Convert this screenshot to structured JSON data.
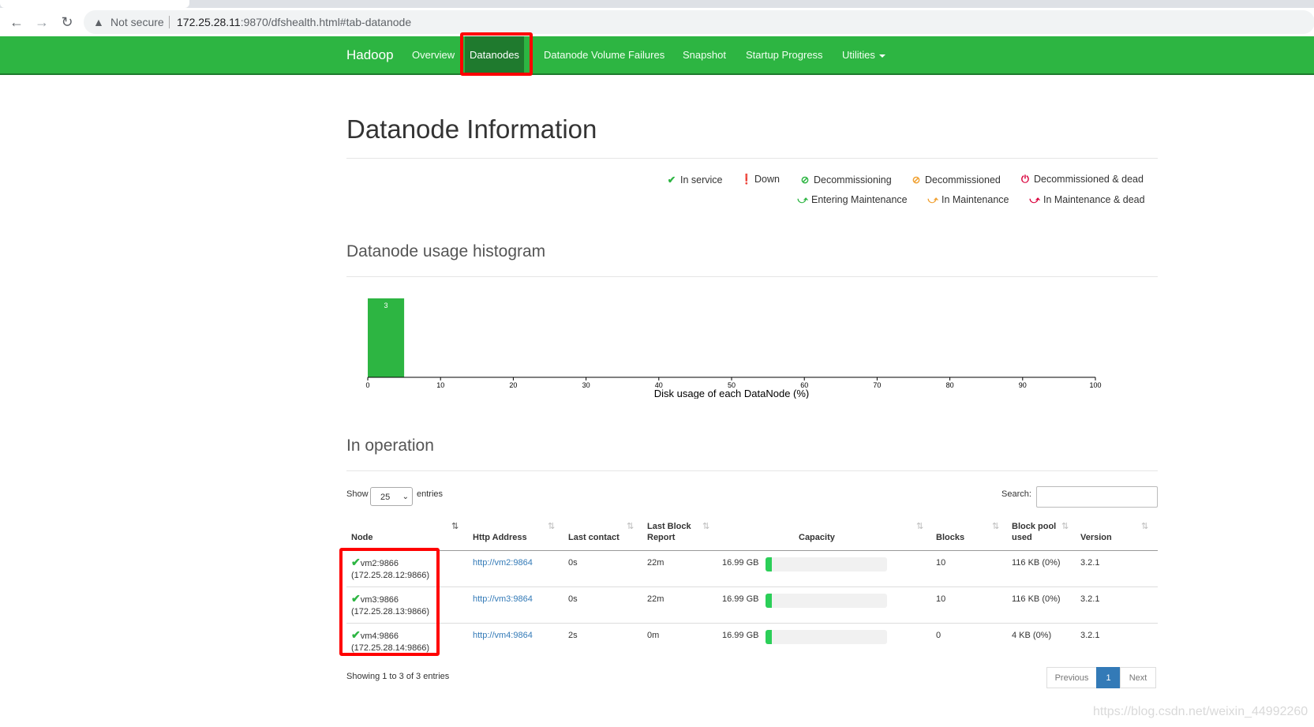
{
  "browser": {
    "security_label": "Not secure",
    "url_host": "172.25.28.11",
    "url_rest": ":9870/dfshealth.html#tab-datanode"
  },
  "navbar": {
    "brand": "Hadoop",
    "items": [
      {
        "label": "Overview"
      },
      {
        "label": "Datanodes"
      },
      {
        "label": "Datanode Volume Failures"
      },
      {
        "label": "Snapshot"
      },
      {
        "label": "Startup Progress"
      },
      {
        "label": "Utilities"
      }
    ],
    "color": "#2db542"
  },
  "page_title": "Datanode Information",
  "legend": [
    {
      "label": "In service",
      "icon": "check-icon",
      "color": "#2db542"
    },
    {
      "label": "Down",
      "icon": "exclamation-circle-icon",
      "color": "#d9003b"
    },
    {
      "label": "Decommissioning",
      "icon": "ban-circle-icon",
      "color": "#2db542"
    },
    {
      "label": "Decommissioned",
      "icon": "ban-circle-icon",
      "color": "#f0a030"
    },
    {
      "label": "Decommissioned & dead",
      "icon": "power-icon",
      "color": "#d9003b"
    },
    {
      "label": "Entering Maintenance",
      "icon": "wrench-icon",
      "color": "#2db542"
    },
    {
      "label": "In Maintenance",
      "icon": "wrench-icon",
      "color": "#f0a030"
    },
    {
      "label": "In Maintenance & dead",
      "icon": "wrench-icon",
      "color": "#d9003b"
    }
  ],
  "histogram": {
    "heading": "Datanode usage histogram",
    "chart_data": {
      "type": "bar",
      "xlabel": "Disk usage of each DataNode (%)",
      "x_ticks": [
        0,
        10,
        20,
        30,
        40,
        50,
        60,
        70,
        80,
        90,
        100
      ],
      "xlim": [
        0,
        100
      ],
      "bins": [
        {
          "x0": 0,
          "x1": 5,
          "count": 3
        }
      ],
      "bar_color": "#2db542"
    }
  },
  "operation": {
    "heading": "In operation",
    "show_label": "Show",
    "page_size": "25",
    "entries_label": "entries",
    "search_label": "Search:",
    "columns": [
      "Node",
      "Http Address",
      "Last contact",
      "Last Block Report",
      "Capacity",
      "Blocks",
      "Block pool used",
      "Version"
    ],
    "rows": [
      {
        "node": "vm2:9866",
        "ip": "(172.25.28.12:9866)",
        "http": "http://vm2:9864",
        "last_contact": "0s",
        "last_block_report": "22m",
        "capacity": "16.99 GB",
        "usage": 0.05,
        "blocks": "10",
        "pool_used": "116 KB (0%)",
        "version": "3.2.1"
      },
      {
        "node": "vm3:9866",
        "ip": "(172.25.28.13:9866)",
        "http": "http://vm3:9864",
        "last_contact": "0s",
        "last_block_report": "22m",
        "capacity": "16.99 GB",
        "usage": 0.05,
        "blocks": "10",
        "pool_used": "116 KB (0%)",
        "version": "3.2.1"
      },
      {
        "node": "vm4:9866",
        "ip": "(172.25.28.14:9866)",
        "http": "http://vm4:9864",
        "last_contact": "2s",
        "last_block_report": "0m",
        "capacity": "16.99 GB",
        "usage": 0.05,
        "blocks": "0",
        "pool_used": "4 KB (0%)",
        "version": "3.2.1"
      }
    ],
    "footer": "Showing 1 to 3 of 3 entries",
    "pager": {
      "previous": "Previous",
      "current": "1",
      "next": "Next"
    }
  },
  "watermark": "https://blog.csdn.net/weixin_44992260"
}
